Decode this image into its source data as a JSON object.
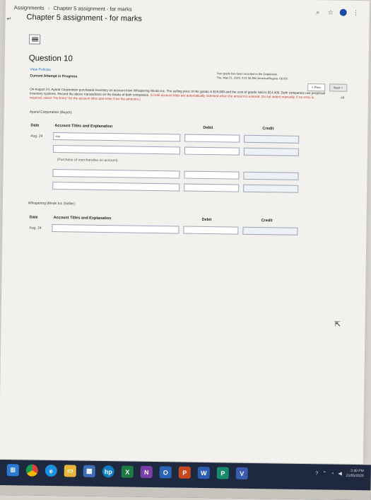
{
  "breadcrumb": [
    "Assignments",
    "Chapter 5 assignment - for marks"
  ],
  "page_title": "Chapter 5 assignment - for marks",
  "question": {
    "title": "Question 10",
    "view_policies": "View Policies",
    "attempt_status": "Current Attempt in Progress",
    "grade_notice": [
      "Your grade has been recorded in the Gradebook.",
      "Thu, May 21, 2020, 2:01:06 AM (America/Regina -06:00)"
    ],
    "prev_label": "< Prev",
    "next_label": "Next >",
    "score": "-/4",
    "description": "On August 24, Ayaral Corporation purchased inventory on account from Whispering Winds Inc. The selling price of the goods is $19,600 and the cost of goods sold is $14,400. Both companies use perpetual inventory systems. Record the above transactions on the books of both companies.",
    "description_red": "(Credit account titles are automatically indented when the amount is entered. Do not indent manually. If no entry is required, select \"No Entry\" for the account titles and enter 0 for the amounts.)",
    "buyer_label": "Ayaral Corporation (Buyer):",
    "seller_label": "Whispering Winds Inc (Seller):"
  },
  "buyer_table": {
    "headers": {
      "date": "Date",
      "account": "Account Titles and Explanation",
      "debit": "Debit",
      "credit": "Credit"
    },
    "date": "Aug. 24",
    "first_value": "abg",
    "note": "(Purchase of merchandise on account)"
  },
  "seller_table": {
    "headers": {
      "date": "Date",
      "account": "Account Titles and Explanation",
      "debit": "Debit",
      "credit": "Credit"
    },
    "date": "Aug. 24"
  },
  "taskbar": {
    "icons": [
      "windows-icon",
      "chrome-icon",
      "browser-icon",
      "folder-icon",
      "store-icon",
      "hp-icon",
      "excel-icon",
      "onenote-icon",
      "onedrive-icon",
      "powerpoint-icon",
      "word-icon",
      "publisher-icon",
      "visio-icon"
    ],
    "clock_time": "2:40 PM",
    "clock_date": "21/05/2020"
  }
}
